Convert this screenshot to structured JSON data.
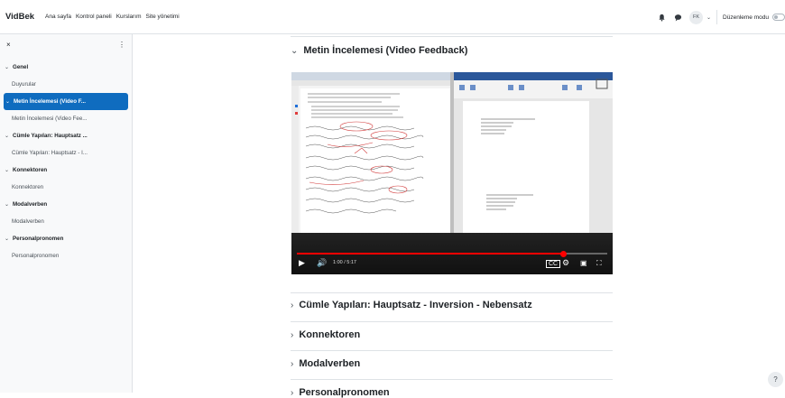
{
  "topbar": {
    "brand": "VidBek",
    "links": [
      "Ana sayfa",
      "Kontrol paneli",
      "Kurslarım",
      "Site yönetimi"
    ],
    "user_initials": "FK",
    "edit_mode_label": "Düzenleme modu",
    "icons": [
      "bell-icon",
      "chat-icon",
      "chevron-down-icon"
    ]
  },
  "drawer": {
    "close": "×",
    "more": "⋮",
    "items": [
      {
        "type": "section",
        "label": "Genel"
      },
      {
        "type": "sub",
        "label": "Duyurular"
      },
      {
        "type": "section",
        "label": "Metin İncelemesi (Video F...",
        "active": true
      },
      {
        "type": "sub",
        "label": "Metin İncelemesi (Video Fee..."
      },
      {
        "type": "section",
        "label": "Cümle Yapıları: Hauptsatz ..."
      },
      {
        "type": "sub",
        "label": "Cümle Yapıları: Hauptsatz - I..."
      },
      {
        "type": "section",
        "label": "Konnektoren"
      },
      {
        "type": "sub",
        "label": "Konnektoren"
      },
      {
        "type": "section",
        "label": "Modalverben"
      },
      {
        "type": "sub",
        "label": "Modalverben"
      },
      {
        "type": "section",
        "label": "Personalpronomen"
      },
      {
        "type": "sub",
        "label": "Personalpronomen"
      }
    ]
  },
  "main": {
    "sections": [
      {
        "title": "Metin İncelemesi (Video Feedback)",
        "expanded": true
      },
      {
        "title": "Cümle Yapıları: Hauptsatz - Inversion - Nebensatz",
        "expanded": false
      },
      {
        "title": "Konnektoren",
        "expanded": false
      },
      {
        "title": "Modalverben",
        "expanded": false
      },
      {
        "title": "Personalpronomen",
        "expanded": false
      }
    ],
    "video": {
      "time": "1:00 / 5:17",
      "progress": 0.86
    }
  },
  "help": "?",
  "colors": {
    "accent": "#0f6cbf",
    "drawer_bg": "#f8f9fa",
    "border": "#dee2e6",
    "progress": "#ff0000"
  }
}
